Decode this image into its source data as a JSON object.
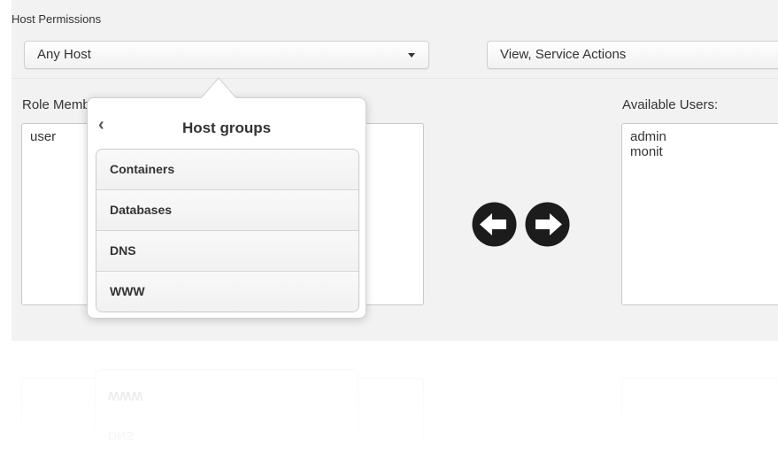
{
  "host_permissions": {
    "title": "Host Permissions",
    "host_select": {
      "selected": "Any Host"
    },
    "permission_select": {
      "selected": "View, Service Actions"
    }
  },
  "role_members": {
    "label": "Role Members:",
    "users": [
      "user"
    ]
  },
  "available_users": {
    "label": "Available Users:",
    "users": [
      "admin",
      "monit"
    ]
  },
  "transfer_buttons": {
    "left_icon": "arrow-left-circle-icon",
    "right_icon": "arrow-right-circle-icon"
  },
  "host_groups_popover": {
    "title": "Host groups",
    "back_icon": "chevron-left-icon",
    "groups": [
      "Containers",
      "Databases",
      "DNS",
      "WWW"
    ]
  },
  "reflection": {
    "items": [
      "WWW",
      "DNS"
    ]
  }
}
